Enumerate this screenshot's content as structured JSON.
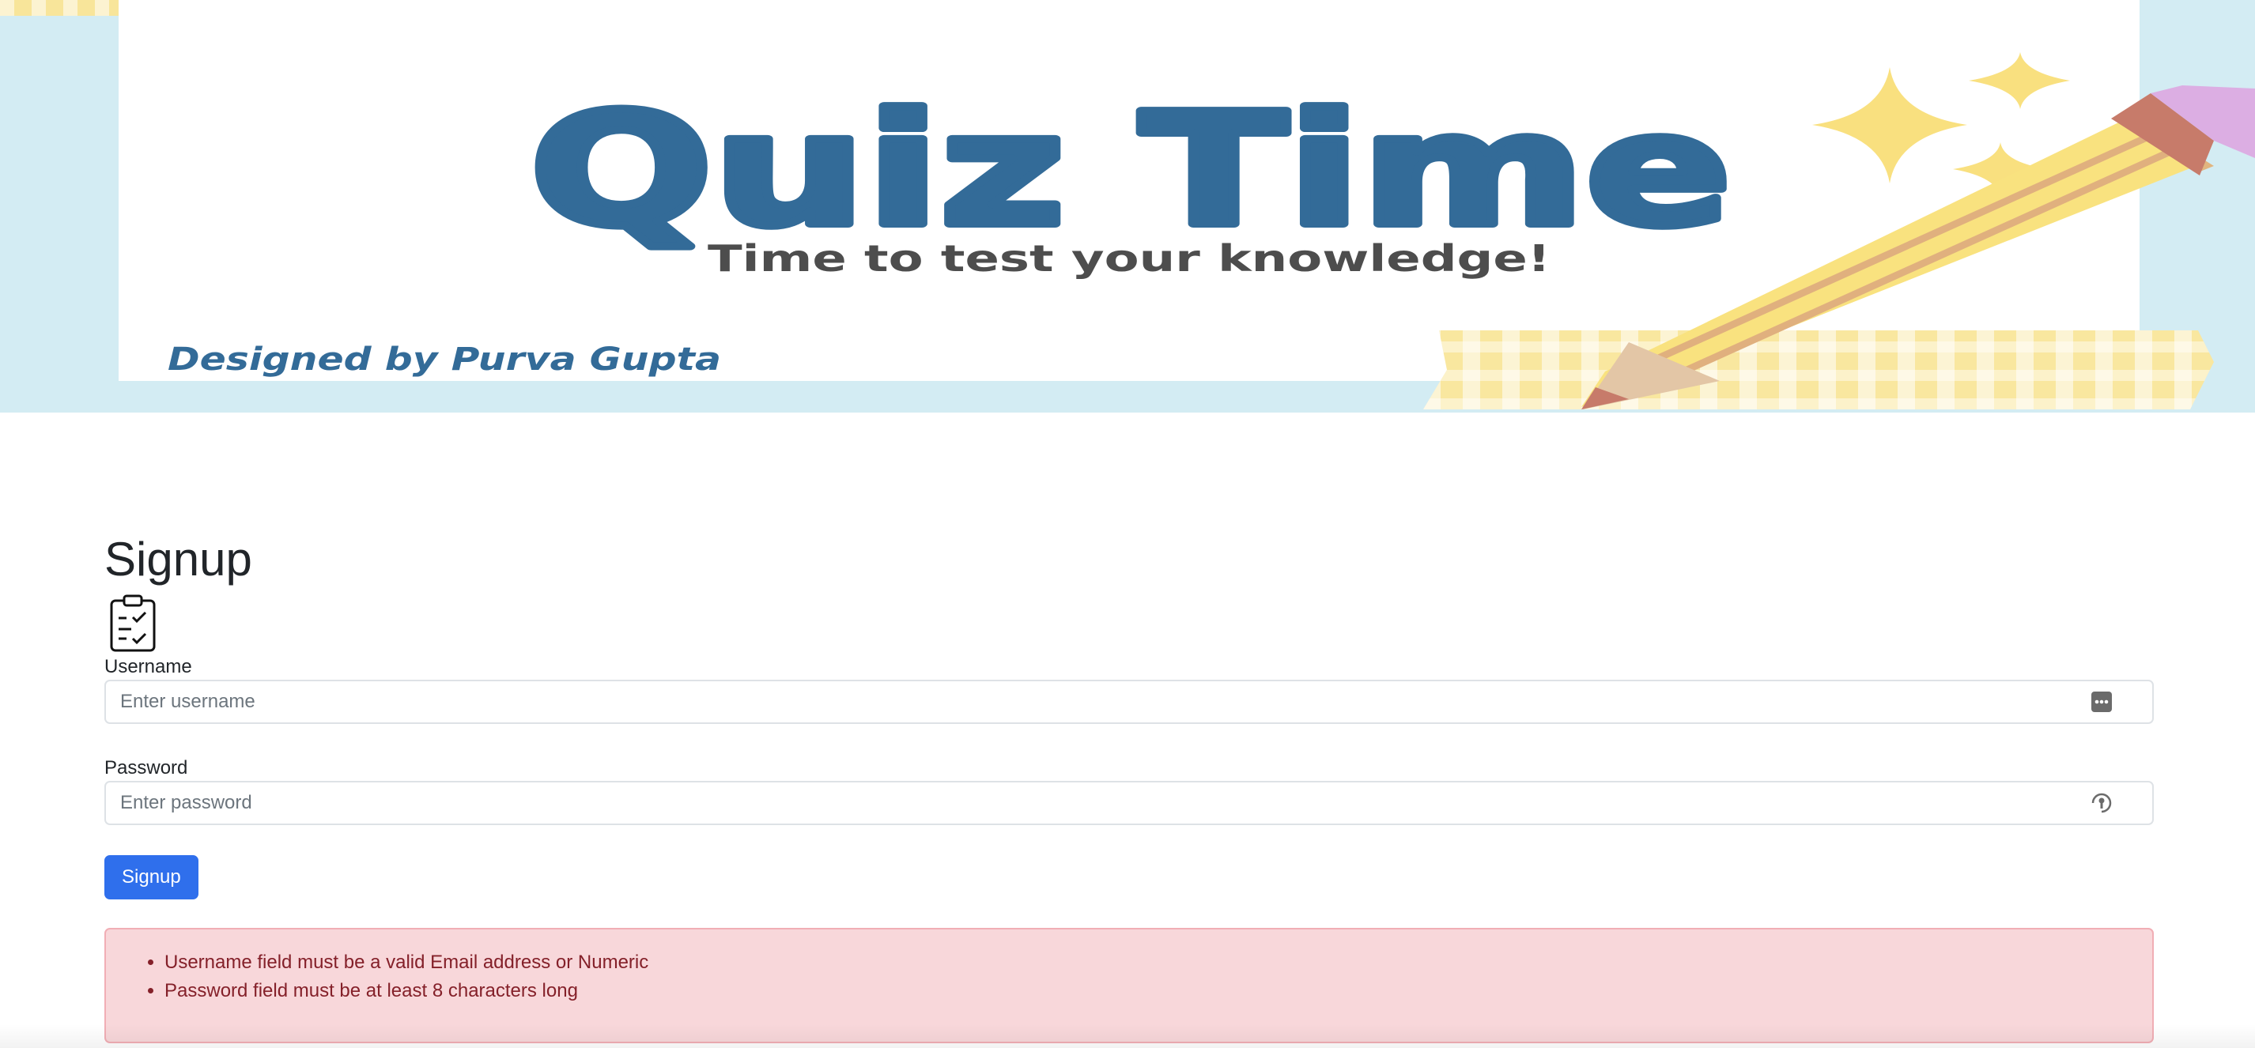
{
  "banner": {
    "title": "Quiz Time",
    "tagline": "Time to test your knowledge!",
    "credit": "Designed by Purva Gupta"
  },
  "signup": {
    "heading": "Signup",
    "icon": "clipboard-check-icon",
    "username": {
      "label": "Username",
      "placeholder": "Enter username",
      "value": "",
      "icon": "password-manager-icon"
    },
    "password": {
      "label": "Password",
      "placeholder": "Enter password",
      "value": "",
      "icon": "password-key-icon"
    },
    "submit_label": "Signup",
    "errors": [
      "Username field must be a valid Email address or Numeric",
      "Password field must be at least 8 characters long"
    ]
  },
  "colors": {
    "banner_bg": "#d3ecf3",
    "title_blue": "#336b98",
    "button_blue": "#2f6fec",
    "alert_bg": "#f8d7da",
    "alert_text": "#842029"
  }
}
